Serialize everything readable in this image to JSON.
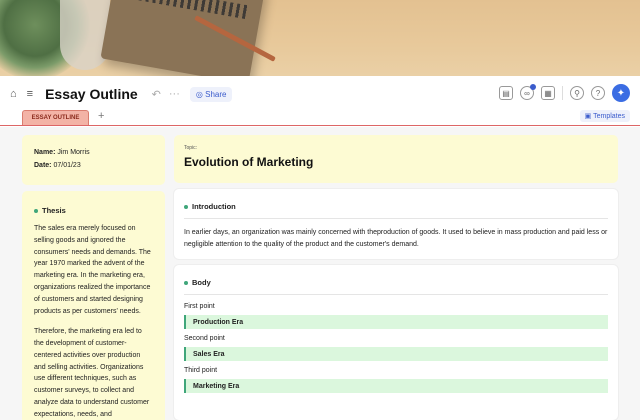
{
  "header": {
    "doc_title": "Essay Outline",
    "share_label": "Share"
  },
  "tabs": {
    "active": "ESSAY OUTLINE",
    "templates_label": "Templates"
  },
  "info": {
    "name_label": "Name:",
    "name_value": "Jim Morris",
    "date_label": "Date:",
    "date_value": "07/01/23"
  },
  "topic": {
    "label": "Topic:",
    "title": "Evolution of Marketing"
  },
  "thesis": {
    "heading": "Thesis",
    "paragraphs": [
      "The sales era merely focused on selling goods and ignored the consumers' needs and demands. The year 1970 marked the advent of the marketing era. In the marketing era, organizations realized the importance of customers and started designing products as per customers' needs.",
      "Therefore, the marketing era led to the development of customer-centered activities over production and selling activities. Organizations use different techniques, such as customer surveys, to collect and analyze data to understand customer expectations, needs, and"
    ]
  },
  "introduction": {
    "heading": "Introduction",
    "text": "In earlier days, an organization was mainly concerned with theproduction of goods. It used to believe in mass production and paid less or negligible attention to the quality of the product and the customer's demand."
  },
  "body": {
    "heading": "Body",
    "points": [
      {
        "label": "First point",
        "era": "Production Era"
      },
      {
        "label": "Second point",
        "era": "Sales Era"
      },
      {
        "label": "Third point",
        "era": "Marketing Era"
      }
    ]
  },
  "colors": {
    "accent": "#3b6de3",
    "tab": "#f3b3a6",
    "yellow_card": "#fdfbd3",
    "era_bg": "#dbf7dd",
    "bullet": "#3fa67a"
  },
  "icons": [
    "home-icon",
    "menu-icon",
    "undo-icon",
    "more-icon",
    "globe-icon",
    "export-icon",
    "share-link-icon",
    "calendar-icon",
    "search-icon",
    "help-icon",
    "ai-assist-icon",
    "templates-icon",
    "add-tab-icon"
  ]
}
